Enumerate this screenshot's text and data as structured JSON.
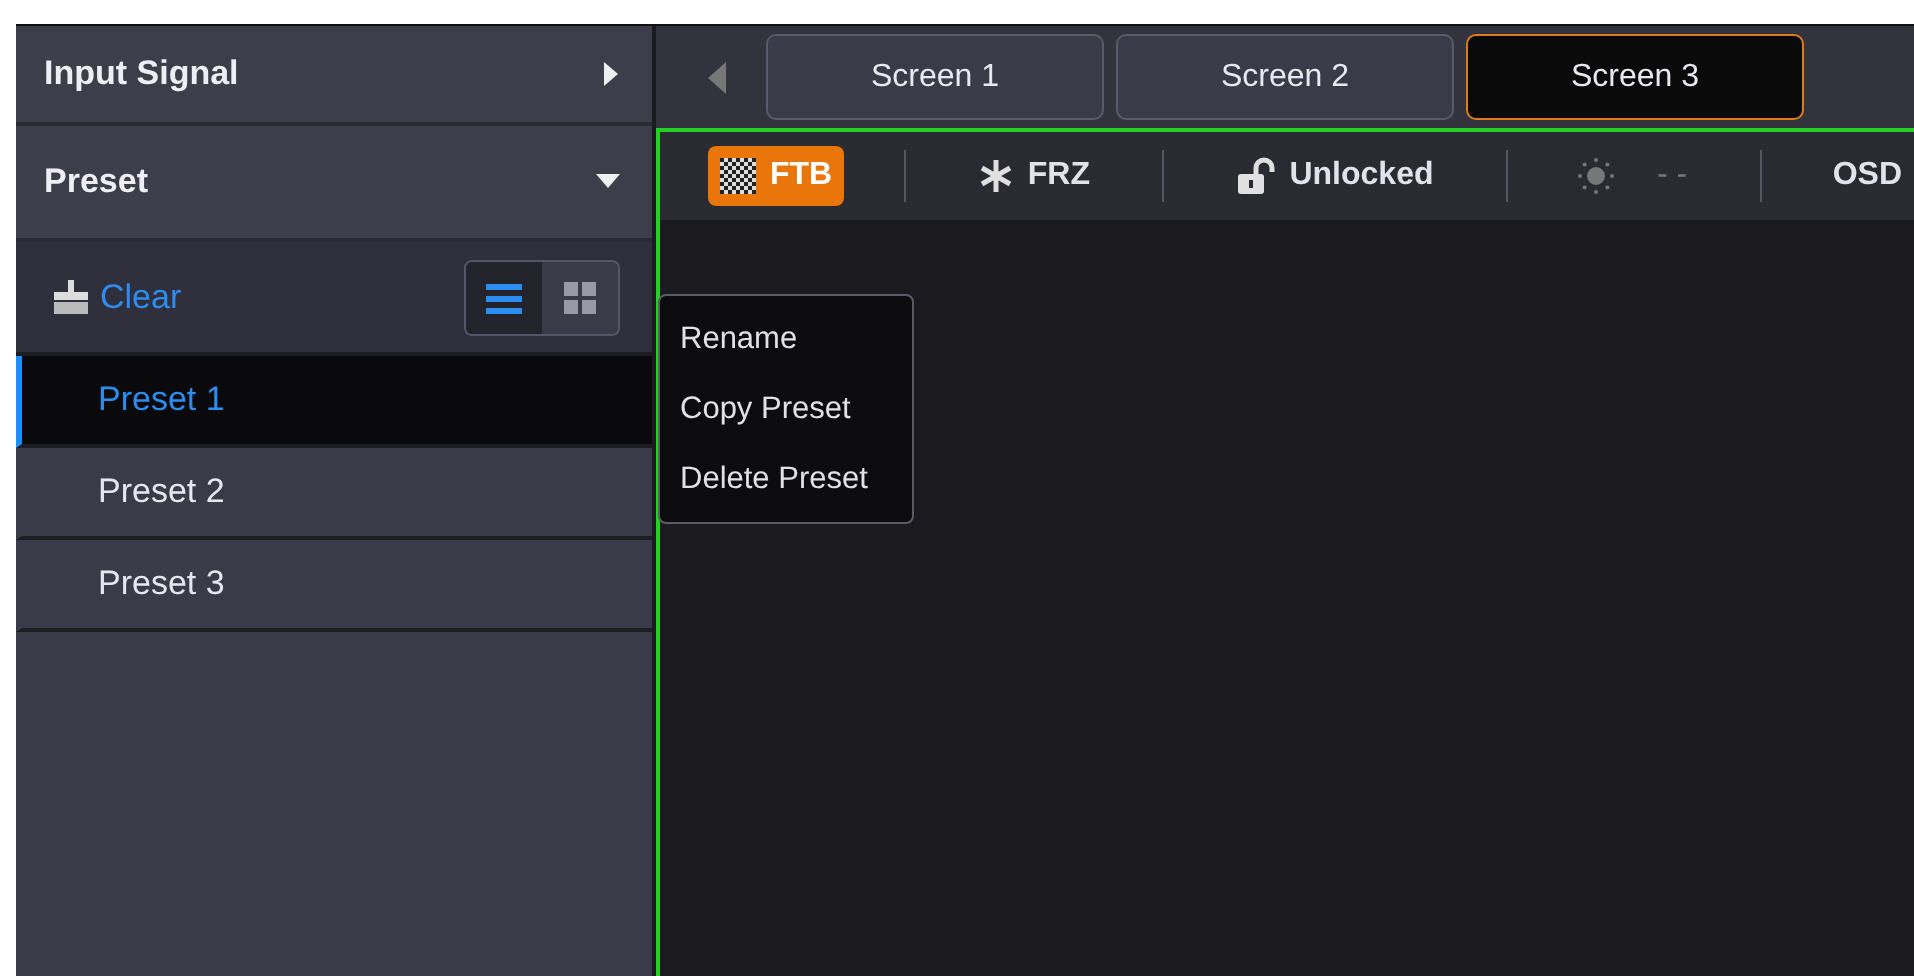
{
  "sidebar": {
    "sections": [
      {
        "title": "Input Signal",
        "expanded": false
      },
      {
        "title": "Preset",
        "expanded": true
      }
    ],
    "clear_button": "Clear",
    "view_toggle": [
      {
        "kind": "list",
        "selected": true
      },
      {
        "kind": "grid",
        "selected": false
      }
    ],
    "presets": [
      {
        "label": "Preset 1",
        "selected": true
      },
      {
        "label": "Preset 2",
        "selected": false
      },
      {
        "label": "Preset 3",
        "selected": false
      }
    ]
  },
  "screen_tabs": [
    {
      "label": "Screen 1",
      "selected": false
    },
    {
      "label": "Screen 2",
      "selected": false
    },
    {
      "label": "Screen 3",
      "selected": true
    }
  ],
  "toolbar": [
    {
      "kind": "ftb",
      "label": "FTB",
      "on": true
    },
    {
      "kind": "freeze",
      "label": "FRZ",
      "on": false
    },
    {
      "kind": "lock",
      "label": "Unlocked",
      "locked": false
    },
    {
      "kind": "brightness",
      "label": "- -"
    },
    {
      "kind": "osd",
      "label": "OSD"
    }
  ],
  "context_menu": [
    "Rename",
    "Copy Preset",
    "Delete Preset"
  ]
}
